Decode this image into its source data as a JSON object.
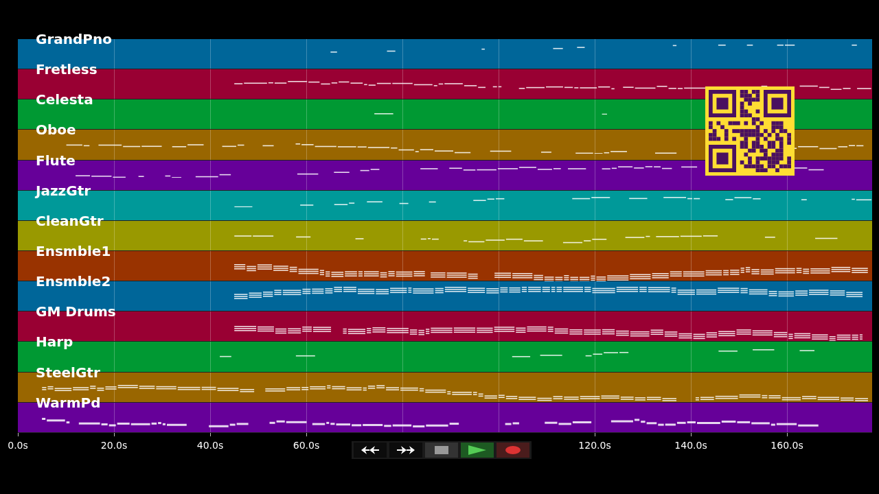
{
  "tracks": [
    {
      "name": "GrandPno",
      "color": "#006699"
    },
    {
      "name": "Fretless",
      "color": "#990033"
    },
    {
      "name": "Celesta",
      "color": "#009933"
    },
    {
      "name": "Oboe",
      "color": "#996600"
    },
    {
      "name": "Flute",
      "color": "#660099"
    },
    {
      "name": "JazzGtr",
      "color": "#009999"
    },
    {
      "name": "CleanGtr",
      "color": "#999900"
    },
    {
      "name": "Ensmble1",
      "color": "#993300"
    },
    {
      "name": "Ensmble2",
      "color": "#006699"
    },
    {
      "name": "GM Drums",
      "color": "#990033"
    },
    {
      "name": "Harp",
      "color": "#009933"
    },
    {
      "name": "SteelGtr",
      "color": "#996600"
    },
    {
      "name": "WarmPd",
      "color": "#660099"
    }
  ],
  "time_axis": {
    "ticks_left": [
      "0.0s",
      "20.0s",
      "40.0s",
      "60.0s"
    ],
    "ticks_right": [
      "120.0s",
      "140.0s",
      "160.0s"
    ]
  },
  "transport": {
    "buttons": [
      {
        "kind": "rewind"
      },
      {
        "kind": "forward"
      },
      {
        "kind": "stop"
      },
      {
        "kind": "play"
      },
      {
        "kind": "record"
      }
    ]
  }
}
